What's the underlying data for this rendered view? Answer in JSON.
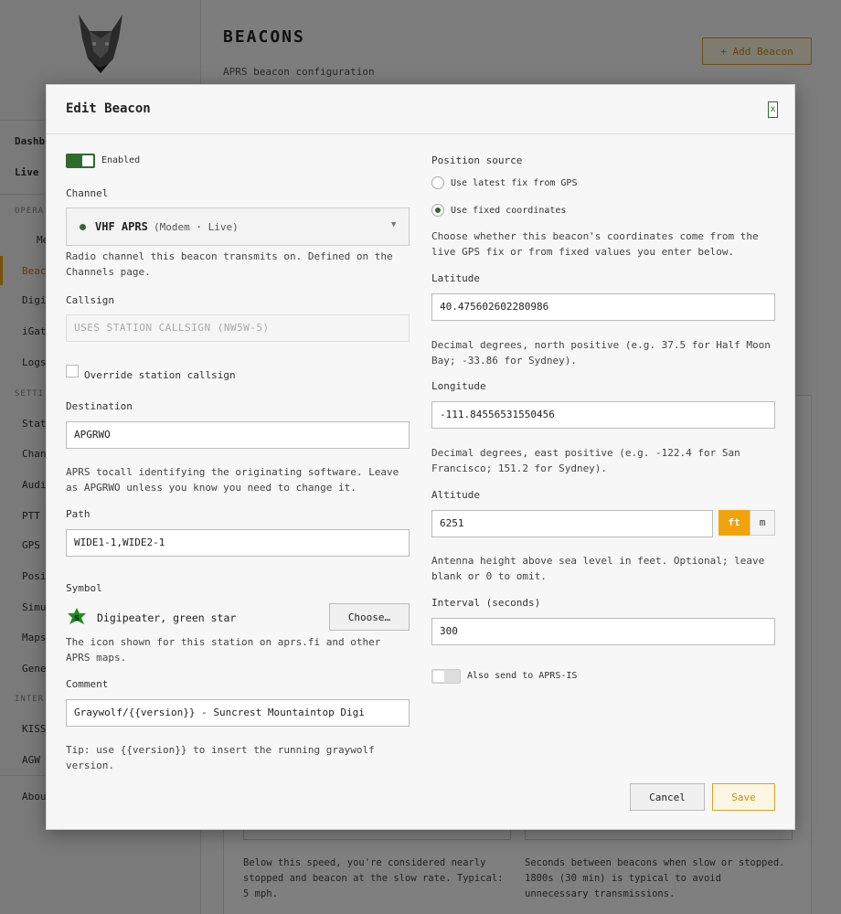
{
  "sidebar": {
    "items": [
      {
        "label": "Dashb",
        "kind": "bold"
      },
      {
        "label": "Live",
        "kind": "bold"
      }
    ],
    "section_operate": "OPERA",
    "operate_items": [
      "Me",
      "Beac",
      "Digi",
      "iGat",
      "Logs"
    ],
    "section_settings": "SETTI",
    "settings_items": [
      "Stat",
      "Chan",
      "Audi",
      "PTT",
      "GPS",
      "Posi",
      "Simu",
      "Maps",
      "Gene"
    ],
    "section_interfaces": "INTER",
    "interface_items": [
      "KISS",
      "AGW"
    ],
    "about": "Abou"
  },
  "page": {
    "title": "BEACONS",
    "subtitle": "APRS beacon configuration",
    "add_button": "+ Add Beacon"
  },
  "background_panel": {
    "speed_help": "Below this speed, you're considered nearly stopped and beacon at the slow rate. Typical: 5 mph.",
    "rate_help": "Seconds between beacons when slow or stopped. 1800s (30 min) is typical to avoid unnecessary transmissions."
  },
  "modal": {
    "title": "Edit Beacon",
    "close_label": "x",
    "enabled": {
      "label": "Enabled",
      "on": true
    },
    "channel": {
      "label": "Channel",
      "name": "VHF APRS",
      "meta": "(Modem · Live)",
      "status_color": "#2e6b2e",
      "help": "Radio channel this beacon transmits on. Defined on the Channels page."
    },
    "callsign": {
      "label": "Callsign",
      "placeholder": "USES STATION CALLSIGN (NW5W-5)",
      "override_label": "Override station callsign",
      "override_checked": false
    },
    "destination": {
      "label": "Destination",
      "value": "APGRWO",
      "help": "APRS tocall identifying the originating software. Leave as APGRWO unless you know you need to change it."
    },
    "path": {
      "label": "Path",
      "value": "WIDE1-1,WIDE2-1"
    },
    "symbol": {
      "label": "Symbol",
      "icon_letter": "S",
      "name": "Digipeater, green star",
      "choose_label": "Choose…",
      "help": "The icon shown for this station on aprs.fi and other APRS maps."
    },
    "comment": {
      "label": "Comment",
      "value": "Graywolf/{{version}} - Suncrest Mountaintop Digi",
      "help": "Tip: use {{version}} to insert the running graywolf version."
    },
    "position_source": {
      "label": "Position source",
      "options": [
        {
          "label": "Use latest fix from GPS",
          "selected": false
        },
        {
          "label": "Use fixed coordinates",
          "selected": true
        }
      ],
      "help": "Choose whether this beacon's coordinates come from the live GPS fix or from fixed values you enter below."
    },
    "latitude": {
      "label": "Latitude",
      "value": "40.475602602280986",
      "help": "Decimal degrees, north positive (e.g. 37.5 for Half Moon Bay; -33.86 for Sydney)."
    },
    "longitude": {
      "label": "Longitude",
      "value": "-111.84556531550456",
      "help": "Decimal degrees, east positive (e.g. -122.4 for San Francisco; 151.2 for Sydney)."
    },
    "altitude": {
      "label": "Altitude",
      "value": "6251",
      "unit_ft": "ft",
      "unit_m": "m",
      "selected_unit": "ft",
      "help": "Antenna height above sea level in feet. Optional; leave blank or 0 to omit."
    },
    "interval": {
      "label": "Interval (seconds)",
      "value": "300"
    },
    "aprs_is": {
      "label": "Also send to APRS-IS",
      "on": false
    },
    "cancel_label": "Cancel",
    "save_label": "Save"
  },
  "colors": {
    "accent": "#f0a30a",
    "green": "#2e6b2e"
  }
}
